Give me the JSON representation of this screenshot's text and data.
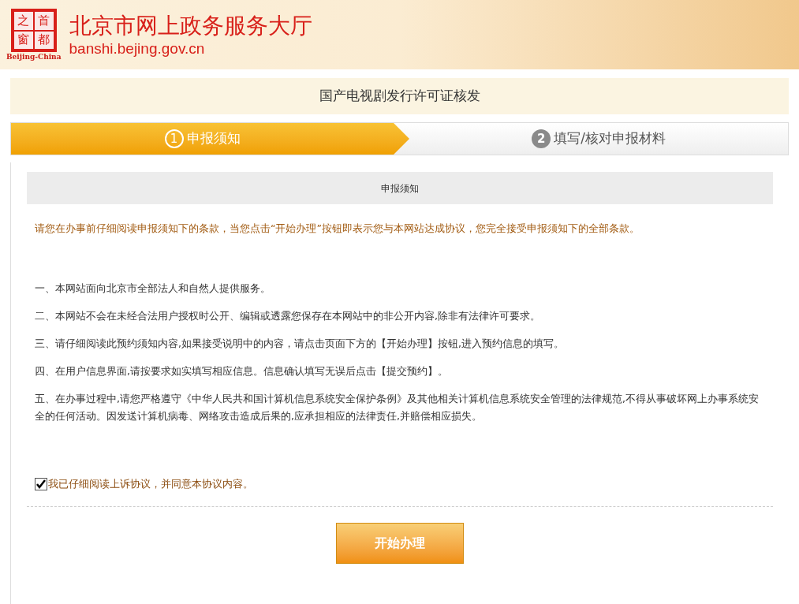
{
  "header": {
    "logo_chars": [
      "之",
      "首",
      "窗",
      "都"
    ],
    "logo_caption": "Beijing-China",
    "site_title": "北京市网上政务服务大厅",
    "site_url": "banshi.bejing.gov.cn"
  },
  "page_title": "国产电视剧发行许可证核发",
  "steps": [
    {
      "number": "1",
      "label": "申报须知",
      "selected": true
    },
    {
      "number": "2",
      "label": "填写/核对申报材料",
      "selected": false
    }
  ],
  "notice": {
    "heading": "申报须知",
    "intro": "请您在办事前仔细阅读申报须知下的条款，当您点击“开始办理”按钮即表示您与本网站达成协议，您完全接受申报须知下的全部条款。",
    "clauses": [
      "一、本网站面向北京市全部法人和自然人提供服务。",
      "二、本网站不会在未经合法用户授权时公开、编辑或透露您保存在本网站中的非公开内容,除非有法律许可要求。",
      "三、请仔细阅读此预约须知内容,如果接受说明中的内容，请点击页面下方的【开始办理】按钮,进入预约信息的填写。",
      "四、在用户信息界面,请按要求如实填写相应信息。信息确认填写无误后点击【提交预约】。",
      "五、在办事过程中,请您严格遵守《中华人民共和国计算机信息系统安全保护条例》及其他相关计算机信息系统安全管理的法律规范,不得从事破坏网上办事系统安全的任何活动。因发送计算机病毒、网络攻击造成后果的,应承担相应的法律责任,并赔偿相应损失。"
    ],
    "agree": {
      "label": "我已仔细阅读上诉协议，并同意本协议内容。",
      "checked": true
    },
    "start_button": "开始办理"
  }
}
